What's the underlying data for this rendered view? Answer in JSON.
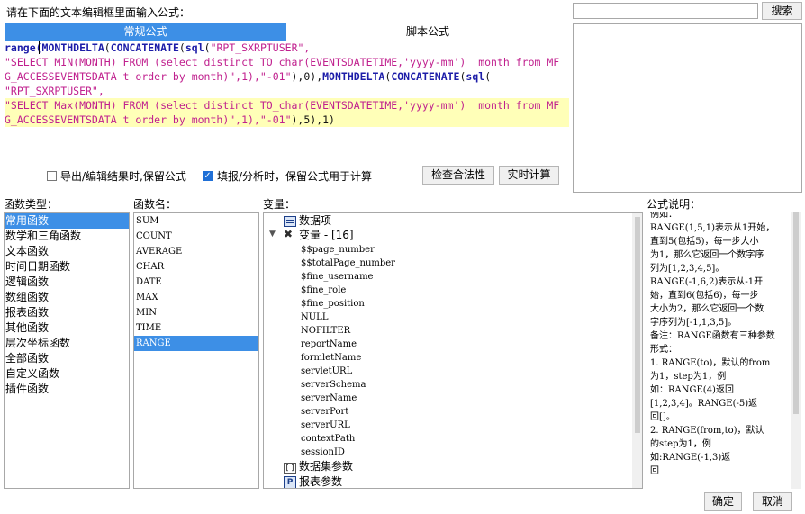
{
  "prompt": "请在下面的文本编辑框里面输入公式：",
  "search": {
    "value": "",
    "button": "搜索"
  },
  "tabs": [
    {
      "label": "常规公式",
      "active": true
    },
    {
      "label": "脚本公式",
      "active": false
    }
  ],
  "editor": {
    "lines": [
      [
        {
          "t": "range(",
          "c": "fn"
        },
        {
          "t": "MONTHDELTA",
          "c": "fn"
        },
        {
          "t": "(",
          "c": "op"
        },
        {
          "t": "CONCATENATE",
          "c": "fn"
        },
        {
          "t": "(",
          "c": "op"
        },
        {
          "t": "sql",
          "c": "fn"
        },
        {
          "t": "(",
          "c": "op"
        },
        {
          "t": "\"RPT_SXRPTUSER\",",
          "c": "str"
        }
      ],
      [
        {
          "t": "\"SELECT MIN(MONTH) FROM (select distinct TO_char(EVENTSDATETIME,'yyyy-mm')  month from MF",
          "c": "str"
        }
      ],
      [
        {
          "t": "G_ACCESSEVENTSDATA t order by month)\",1),",
          "c": "str"
        },
        {
          "t": "\"-01\"",
          "c": "str"
        },
        {
          "t": "),0),",
          "c": "op"
        },
        {
          "t": "MONTHDELTA",
          "c": "fn"
        },
        {
          "t": "(",
          "c": "op"
        },
        {
          "t": "CONCATENATE",
          "c": "fn"
        },
        {
          "t": "(",
          "c": "op"
        },
        {
          "t": "sql",
          "c": "fn"
        },
        {
          "t": "(",
          "c": "op"
        }
      ],
      [
        {
          "t": "\"RPT_SXRPTUSER\",",
          "c": "str"
        }
      ],
      [
        {
          "t": "\"SELECT Max(MONTH) FROM (select distinct TO_char(EVENTSDATETIME,'yyyy-mm')  month from MF",
          "c": "str"
        }
      ],
      [
        {
          "t": "G_ACCESSEVENTSDATA t order by month)\",1),",
          "c": "str"
        },
        {
          "t": "\"-01\"",
          "c": "str"
        },
        {
          "t": "),5),1)",
          "c": "op"
        }
      ]
    ]
  },
  "options": {
    "export_keep": {
      "label": "导出/编辑结果时,保留公式",
      "checked": false
    },
    "fill_keep": {
      "label": "填报/分析时，保留公式用于计算",
      "checked": true
    },
    "check_button": "检查合法性",
    "realtime_button": "实时计算"
  },
  "headers": {
    "func_type": "函数类型：",
    "func_name": "函数名：",
    "variable": "变量：",
    "formula_desc": "公式说明："
  },
  "func_types": [
    "常用函数",
    "数学和三角函数",
    "文本函数",
    "时间日期函数",
    "逻辑函数",
    "数组函数",
    "报表函数",
    "其他函数",
    "层次坐标函数",
    "全部函数",
    "自定义函数",
    "插件函数"
  ],
  "func_types_selected": 0,
  "func_names": [
    "SUM",
    "COUNT",
    "AVERAGE",
    "CHAR",
    "DATE",
    "MAX",
    "MIN",
    "TIME",
    "RANGE"
  ],
  "func_names_selected": 8,
  "variables": {
    "data_item": "数据项",
    "var_group": "变量 - [16]",
    "vars": [
      "$$page_number",
      "$$totalPage_number",
      "$fine_username",
      "$fine_role",
      "$fine_position",
      "NULL",
      "NOFILTER",
      "reportName",
      "formletName",
      "servletURL",
      "serverSchema",
      "serverName",
      "serverPort",
      "serverURL",
      "contextPath",
      "sessionID"
    ],
    "dataset_params": "数据集参数",
    "report_params": "报表参数"
  },
  "description": [
    "例如：",
    "RANGE(1,5,1)表示从1开始，",
    "直到5(包括5)，每一步大小",
    "为1，那么它返回一个数字序",
    "列为[1,2,3,4,5]。",
    "RANGE(-1,6,2)表示从-1开",
    "始，直到6(包括6)，每一步",
    "大小为2，那么它返回一个数",
    "字序列为[-1,1,3,5]。",
    "备注：RANGE函数有三种参数",
    "形式：",
    "1. RANGE(to)，默认的from",
    "为1，step为1，例",
    "如：RANGE(4)返回",
    "[1,2,3,4]。RANGE(-5)返",
    "回[]。",
    "2. RANGE(from,to)，默认",
    "的step为1，例",
    "如:RANGE(-1,3)返",
    "回"
  ],
  "footer": {
    "ok": "确定",
    "cancel": "取消"
  }
}
